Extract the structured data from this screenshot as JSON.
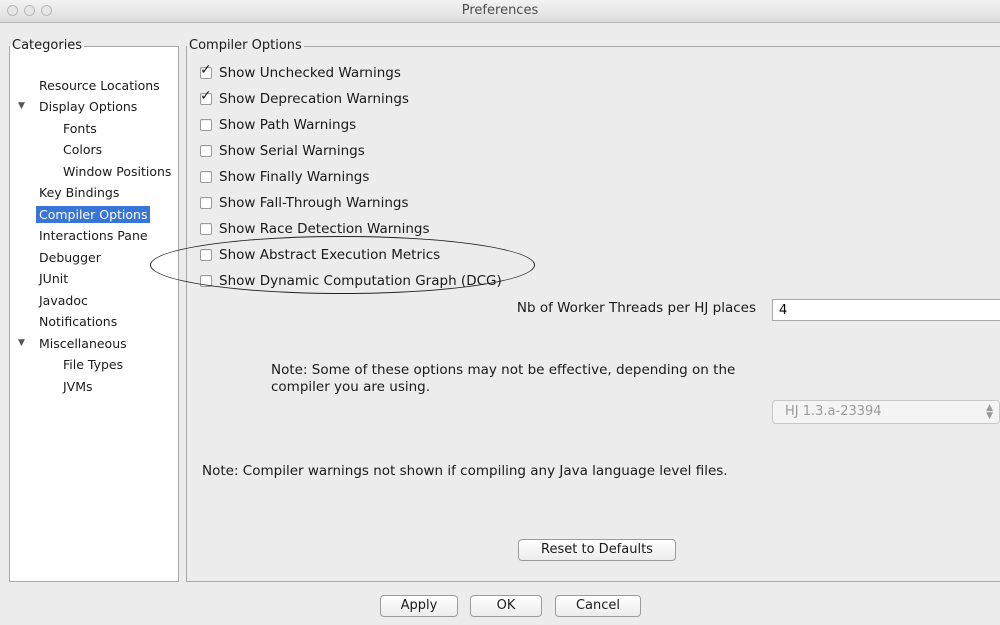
{
  "window": {
    "title": "Preferences"
  },
  "categories": {
    "legend": "Categories",
    "items": [
      "Resource Locations",
      "Display Options",
      "Fonts",
      "Colors",
      "Window Positions",
      "Key Bindings",
      "Compiler Options",
      "Interactions Pane",
      "Debugger",
      "JUnit",
      "Javadoc",
      "Notifications",
      "Miscellaneous",
      "File Types",
      "JVMs"
    ],
    "selected": "Compiler Options",
    "expand_arrow": "▼"
  },
  "compiler": {
    "legend": "Compiler Options",
    "options": [
      {
        "label": "Show Unchecked Warnings",
        "checked": true
      },
      {
        "label": "Show Deprecation Warnings",
        "checked": true
      },
      {
        "label": "Show Path Warnings",
        "checked": false
      },
      {
        "label": "Show Serial Warnings",
        "checked": false
      },
      {
        "label": "Show Finally Warnings",
        "checked": false
      },
      {
        "label": "Show Fall-Through Warnings",
        "checked": false
      },
      {
        "label": "Show Race Detection Warnings",
        "checked": false
      },
      {
        "label": "Show Abstract Execution Metrics",
        "checked": false
      },
      {
        "label": "Show Dynamic Computation Graph (DCG)",
        "checked": false
      }
    ],
    "check_mark": "✓",
    "threads_label": "Nb of Worker Threads per HJ places",
    "threads_value": "4",
    "note1": "Note: Some of these options may not be effective, depending on the compiler you are using.",
    "compiler_select": "HJ 1.3.a-23394",
    "note2": "Note: Compiler warnings not shown if compiling any Java language level files.",
    "reset_label": "Reset to Defaults"
  },
  "footer": {
    "apply": "Apply",
    "ok": "OK",
    "cancel": "Cancel"
  }
}
